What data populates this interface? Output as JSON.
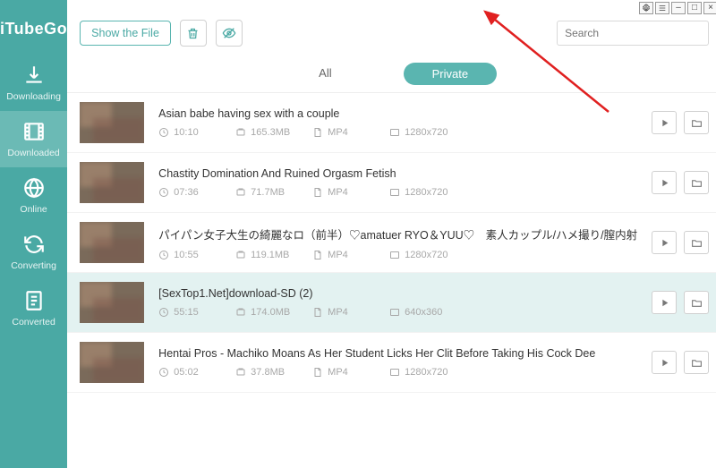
{
  "app": {
    "name": "iTubeGo"
  },
  "toolbar": {
    "show_file": "Show the File",
    "search_placeholder": "Search"
  },
  "sidebar": {
    "items": [
      {
        "label": "Downloading",
        "icon": "download-icon"
      },
      {
        "label": "Downloaded",
        "icon": "film-icon"
      },
      {
        "label": "Online",
        "icon": "globe-icon"
      },
      {
        "label": "Converting",
        "icon": "refresh-icon"
      },
      {
        "label": "Converted",
        "icon": "document-icon"
      }
    ]
  },
  "tabs": {
    "all": "All",
    "private": "Private"
  },
  "videos": [
    {
      "title": "Asian babe having sex with a couple",
      "duration": "10:10",
      "size": "165.3MB",
      "format": "MP4",
      "resolution": "1280x720"
    },
    {
      "title": "Chastity Domination And Ruined Orgasm Fetish",
      "duration": "07:36",
      "size": "71.7MB",
      "format": "MP4",
      "resolution": "1280x720"
    },
    {
      "title": "パイパン女子大生の綺麗なロ（前半）♡amatuer RYO＆YUU♡　素人カップル/ハメ撮り/膣内射",
      "duration": "10:55",
      "size": "119.1MB",
      "format": "MP4",
      "resolution": "1280x720"
    },
    {
      "title": "[SexTop1.Net]download-SD (2)",
      "duration": "55:15",
      "size": "174.0MB",
      "format": "MP4",
      "resolution": "640x360"
    },
    {
      "title": "Hentai Pros - Machiko Moans As Her Student Licks Her Clit Before Taking His Cock Dee",
      "duration": "05:02",
      "size": "37.8MB",
      "format": "MP4",
      "resolution": "1280x720"
    }
  ],
  "colors": {
    "accent": "#4aa9a4",
    "accent_light": "#5ab5b0",
    "selected_row": "#e3f2f1"
  }
}
